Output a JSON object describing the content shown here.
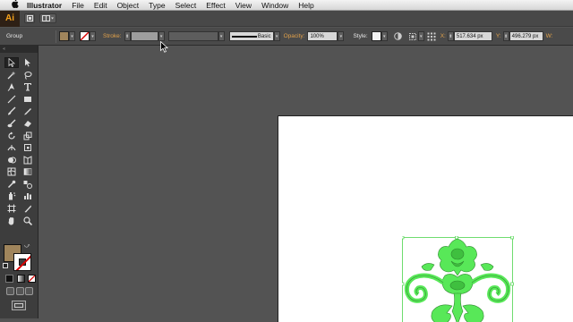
{
  "menubar": {
    "apple": "",
    "items": [
      "Illustrator",
      "File",
      "Edit",
      "Object",
      "Type",
      "Select",
      "Effect",
      "View",
      "Window",
      "Help"
    ]
  },
  "appbar": {
    "logo": "Ai",
    "icons": [
      "document-icon",
      "arrange-documents-icon"
    ]
  },
  "control": {
    "selection_label": "Group",
    "stroke_label": "Stroke:",
    "stroke_weight": "",
    "stroke_profile": "Basic",
    "opacity_label": "Opacity:",
    "opacity_value": "100%",
    "style_label": "Style:",
    "x_label": "X:",
    "x_value": "517.634 px",
    "y_label": "Y:",
    "y_value": "496.279 px",
    "w_label": "W:"
  },
  "tools": {
    "header": "«",
    "items": [
      "selection",
      "direct-selection",
      "magic-wand",
      "lasso",
      "pen",
      "type",
      "line-segment",
      "rectangle",
      "paintbrush",
      "pencil",
      "blob-brush",
      "eraser",
      "rotate",
      "scale",
      "width",
      "free-transform",
      "shape-builder",
      "perspective-grid",
      "mesh",
      "gradient",
      "eyedropper",
      "blend",
      "symbol-sprayer",
      "column-graph",
      "artboard",
      "slice",
      "hand",
      "zoom"
    ]
  },
  "colors": {
    "fill": "#a0855c",
    "stroke": "none",
    "selection": "#4cd44c",
    "accent_label": "#e1a14a"
  }
}
